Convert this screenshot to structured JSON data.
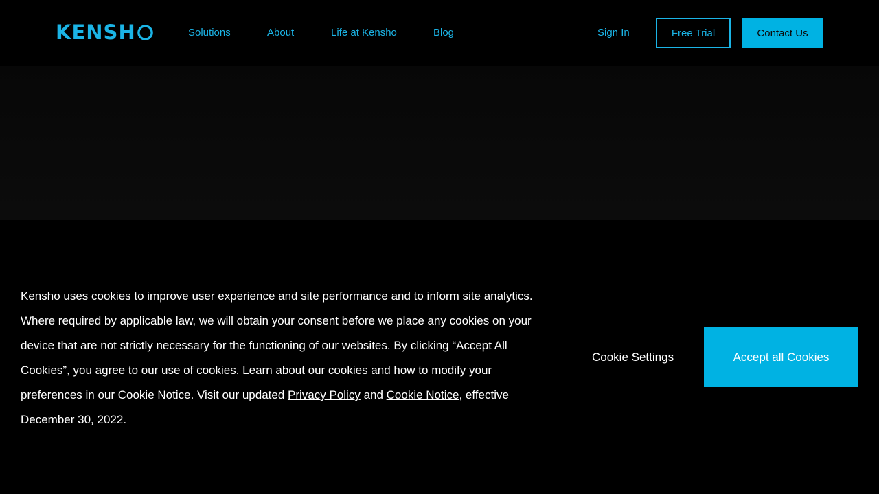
{
  "header": {
    "logo_text": "KENSH",
    "logo_icon": "kensho-o-icon",
    "nav": [
      {
        "label": "Solutions"
      },
      {
        "label": "About"
      },
      {
        "label": "Life at Kensho"
      },
      {
        "label": "Blog"
      }
    ],
    "sign_in": "Sign In",
    "free_trial": "Free Trial",
    "contact_us": "Contact Us"
  },
  "cookie_banner": {
    "text_before": "Kensho uses cookies to improve user experience and site performance and to inform site analytics. Where required by applicable law, we will obtain your consent before we place any cookies on your device that are not strictly necessary for the functioning of our websites. By clicking “Accept All Cookies”, you agree to our use of cookies. Learn about our cookies and how to modify your preferences in our Cookie Notice. Visit our updated ",
    "privacy_link": "Privacy Policy",
    "and_text": " and ",
    "cookie_notice_link": "Cookie Notice",
    "text_after": ", effective December 30, 2022.",
    "settings_label": "Cookie Settings",
    "accept_label": "Accept all Cookies"
  },
  "colors": {
    "accent": "#1bb4e6",
    "button_fill": "#00b2e3",
    "background": "#000000"
  }
}
